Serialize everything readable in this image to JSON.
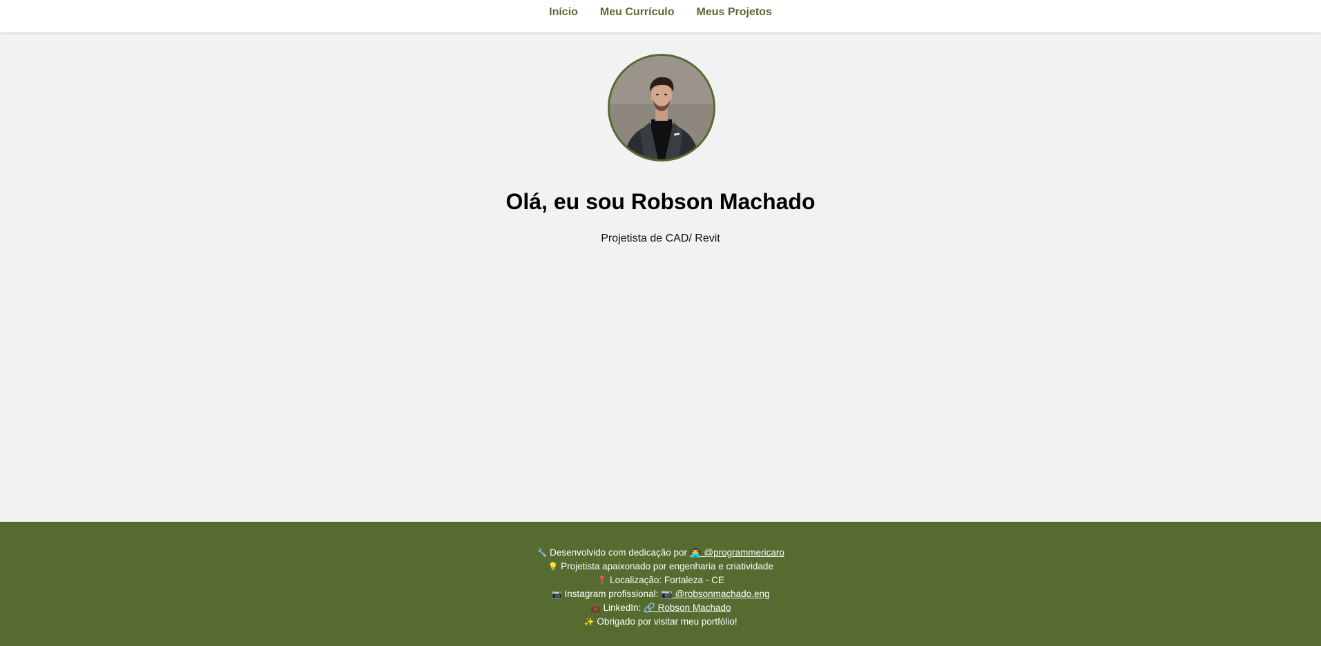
{
  "nav": {
    "items": [
      {
        "label": "Início"
      },
      {
        "label": "Meu Currículo"
      },
      {
        "label": "Meus Projetos"
      }
    ]
  },
  "hero": {
    "title": "Olá, eu sou Robson Machado",
    "subtitle": "Projetista de CAD/ Revit"
  },
  "footer": {
    "dev_prefix": "Desenvolvido com dedicação por",
    "dev_link": "@programmericaro",
    "tagline": "Projetista apaixonado por engenharia e criatividade",
    "location": "Localização: Fortaleza - CE",
    "instagram_prefix": "Instagram profissional:",
    "instagram_link": "@robsonmachado.eng",
    "linkedin_prefix": "LinkedIn:",
    "linkedin_link": "Robson Machado",
    "thanks": "Obrigado por visitar meu portfólio!"
  },
  "icons": {
    "wrench": "🔧",
    "developer": "👨‍💻",
    "bulb": "💡",
    "pin": "📍",
    "camera": "📷",
    "briefcase": "💼",
    "link": "🔗",
    "sparkles": "✨"
  },
  "colors": {
    "accent": "#556b2f",
    "background": "#f2f2f2",
    "nav_bg": "#ffffff",
    "footer_text": "#ffffff"
  }
}
